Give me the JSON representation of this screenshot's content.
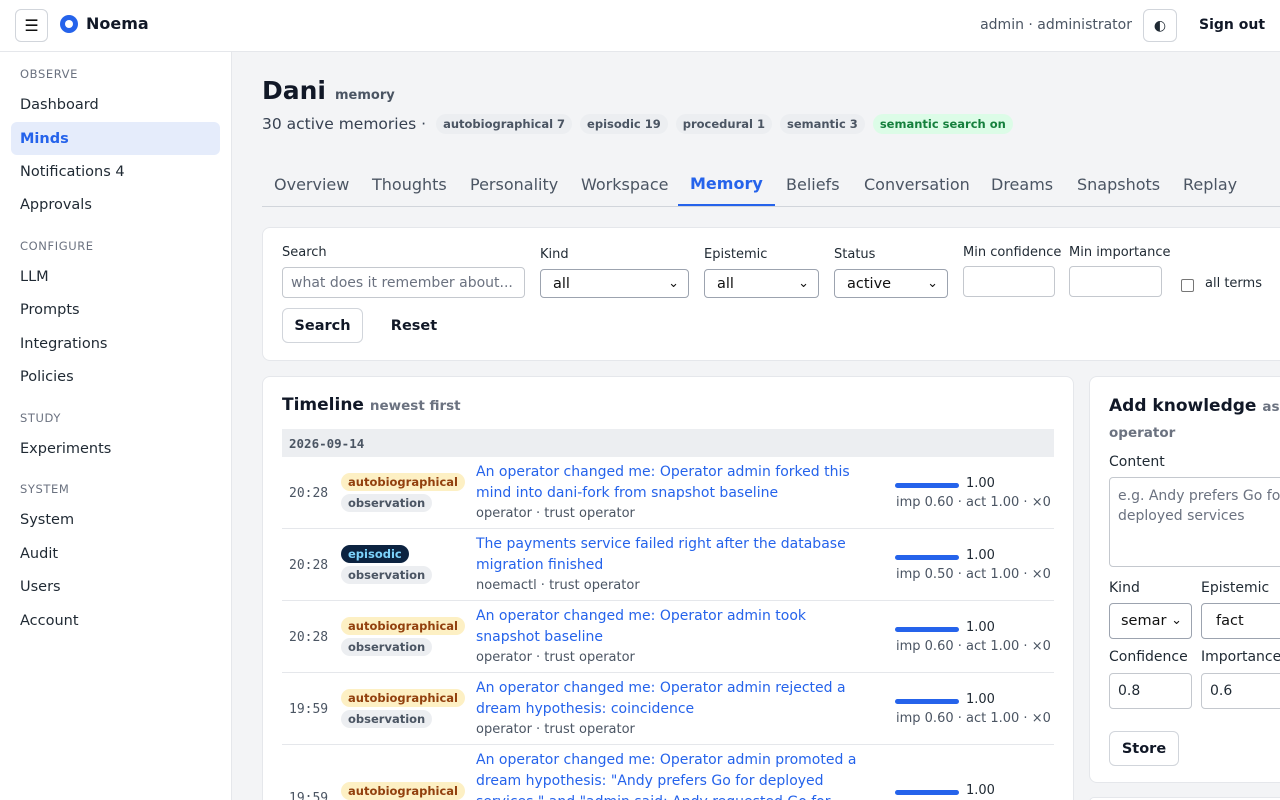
{
  "topbar": {
    "menu_glyph": "☰",
    "brand": "Noema",
    "user": "admin · administrator",
    "theme_glyph": "◐",
    "signout": "Sign out"
  },
  "sidebar": {
    "sections": [
      {
        "title": "OBSERVE",
        "items": [
          "Dashboard",
          "Minds",
          "Notifications 4",
          "Approvals"
        ]
      },
      {
        "title": "CONFIGURE",
        "items": [
          "LLM",
          "Prompts",
          "Integrations",
          "Policies"
        ]
      },
      {
        "title": "STUDY",
        "items": [
          "Experiments"
        ]
      },
      {
        "title": "SYSTEM",
        "items": [
          "System",
          "Audit",
          "Users",
          "Account"
        ]
      }
    ],
    "active": "Minds"
  },
  "header": {
    "name": "Dani",
    "subtitle": "memory",
    "summary": "30 active memories ·",
    "pills": [
      "autobiographical 7",
      "episodic 19",
      "procedural 1",
      "semantic 3"
    ],
    "search_pill": "semantic search on"
  },
  "tabs": [
    "Overview",
    "Thoughts",
    "Personality",
    "Workspace",
    "Memory",
    "Beliefs",
    "Conversation",
    "Dreams",
    "Snapshots",
    "Replay"
  ],
  "active_tab": "Memory",
  "filters": {
    "search_label": "Search",
    "search_placeholder": "what does it remember about...",
    "kind_label": "Kind",
    "kind_value": "all",
    "epistemic_label": "Epistemic",
    "epistemic_value": "all",
    "status_label": "Status",
    "status_value": "active",
    "min_conf_label": "Min confidence",
    "min_imp_label": "Min importance",
    "all_terms_label": "all terms",
    "search_button": "Search",
    "reset_button": "Reset",
    "chevron": "⌄"
  },
  "timeline": {
    "title": "Timeline",
    "subtitle": "newest first",
    "date": "2026-09-14",
    "rows": [
      {
        "time": "20:28",
        "kind": "autobiographical",
        "epistemic": "observation",
        "text": "An operator changed me: Operator admin forked this mind into dani-fork from snapshot baseline",
        "meta": "operator · trust operator",
        "confidence": "1.00",
        "confidence_fraction": 1.0,
        "stats": "imp 0.60 · act 1.00 · ×0"
      },
      {
        "time": "20:28",
        "kind": "episodic",
        "epistemic": "observation",
        "text": "The payments service failed right after the database migration finished",
        "meta": "noemactl · trust operator",
        "confidence": "1.00",
        "confidence_fraction": 1.0,
        "stats": "imp 0.50 · act 1.00 · ×0"
      },
      {
        "time": "20:28",
        "kind": "autobiographical",
        "epistemic": "observation",
        "text": "An operator changed me: Operator admin took snapshot baseline",
        "meta": "operator · trust operator",
        "confidence": "1.00",
        "confidence_fraction": 1.0,
        "stats": "imp 0.60 · act 1.00 · ×0"
      },
      {
        "time": "19:59",
        "kind": "autobiographical",
        "epistemic": "observation",
        "text": "An operator changed me: Operator admin rejected a dream hypothesis: coincidence",
        "meta": "operator · trust operator",
        "confidence": "1.00",
        "confidence_fraction": 1.0,
        "stats": "imp 0.60 · act 1.00 · ×0"
      },
      {
        "time": "19:59",
        "kind": "autobiographical",
        "epistemic": "",
        "text": "An operator changed me: Operator admin promoted a dream hypothesis: \"Andy prefers Go for deployed services.\" and \"admin said: Andy requested Go for project",
        "meta": "",
        "confidence": "1.00",
        "confidence_fraction": 1.0,
        "stats": ""
      }
    ]
  },
  "add_knowledge": {
    "title": "Add knowledge",
    "subtitle": "as operator",
    "content_label": "Content",
    "content_placeholder": "e.g. Andy prefers Go for deployed services",
    "kind_label": "Kind",
    "kind_value": "semar",
    "epistemic_label": "Epistemic",
    "epistemic_value": "fact",
    "confidence_label": "Confidence",
    "confidence_value": "0.8",
    "importance_label": "Importance",
    "importance_value": "0.6",
    "store_button": "Store"
  },
  "colors": {
    "accent": "#2563eb",
    "nav_active_bg": "#e5ecfb",
    "auto_badge_bg": "#fdf0c4",
    "episodic_badge_bg": "#0c2340",
    "search_on_bg": "#dcfce7"
  }
}
